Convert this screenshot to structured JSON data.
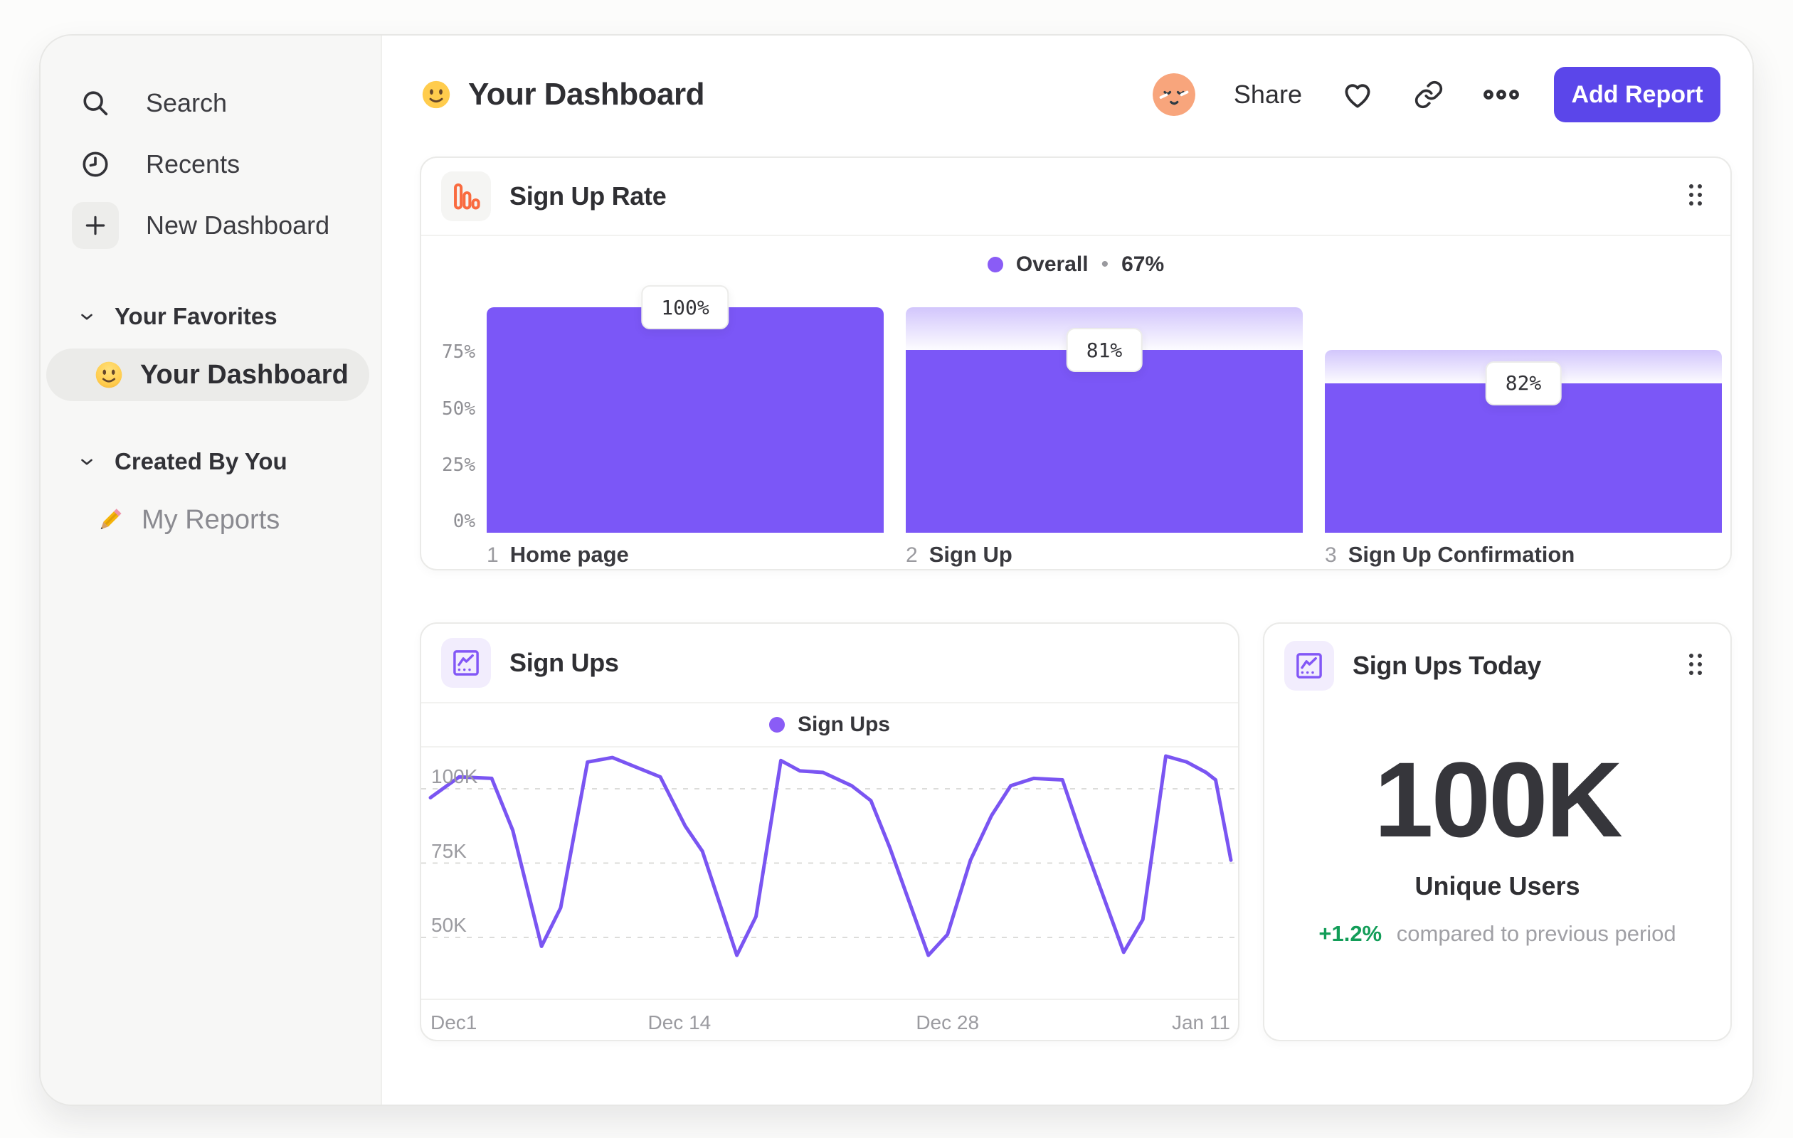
{
  "page": {
    "title": "Your Dashboard",
    "title_emoji": "slightly-smiling-face"
  },
  "sidebar": {
    "items": [
      {
        "label": "Search",
        "icon": "search-icon"
      },
      {
        "label": "Recents",
        "icon": "clock-icon"
      },
      {
        "label": "New Dashboard",
        "icon": "plus-icon"
      }
    ],
    "sections": [
      {
        "label": "Your Favorites",
        "items": [
          {
            "emoji": "🙂",
            "label": "Your Dashboard",
            "active": true
          }
        ]
      },
      {
        "label": "Created By You",
        "items": [
          {
            "emoji": "✏️",
            "label": "My Reports",
            "active": false
          }
        ]
      }
    ]
  },
  "header": {
    "share_label": "Share",
    "add_report_label": "Add Report"
  },
  "cards": {
    "funnel": {
      "title": "Sign Up Rate",
      "legend": {
        "name": "Overall",
        "sep": "•",
        "value": "67%"
      }
    },
    "line": {
      "title": "Sign Ups",
      "legend": {
        "name": "Sign Ups"
      }
    },
    "today": {
      "title": "Sign Ups Today",
      "value": "100K",
      "label": "Unique Users",
      "delta": "+1.2%",
      "delta_note": "compared to previous period"
    }
  },
  "colors": {
    "accent_purple": "#7b57f7",
    "button_purple": "#5b46ea",
    "icon_orange": "#f96b40",
    "delta_green": "#129d58",
    "legend_dot": "#8a5cf6"
  },
  "chart_data": [
    {
      "type": "bar",
      "subtype": "funnel",
      "title": "Sign Up Rate",
      "series": "Overall",
      "overall_conversion": "67%",
      "categories": [
        "Home page",
        "Sign Up",
        "Sign Up Confirmation"
      ],
      "step_numbers": [
        "1",
        "2",
        "3"
      ],
      "step_conversion_labels": [
        "100%",
        "81%",
        "82%"
      ],
      "cumulative_pct": [
        100,
        81,
        66.4
      ],
      "prev_cumulative_pct": [
        100,
        100,
        81
      ],
      "y_ticks": [
        {
          "v": 0,
          "label": "0%"
        },
        {
          "v": 25,
          "label": "25%"
        },
        {
          "v": 50,
          "label": "50%"
        },
        {
          "v": 75,
          "label": "75%"
        }
      ],
      "ylim": [
        0,
        100
      ],
      "grid": false,
      "legend_position": "top-center"
    },
    {
      "type": "line",
      "title": "Sign Ups",
      "series": "Sign Ups",
      "unit": "K",
      "x_ticks": [
        {
          "day": 0,
          "label": "Dec1"
        },
        {
          "day": 13,
          "label": "Dec 14"
        },
        {
          "day": 27,
          "label": "Dec 28"
        },
        {
          "day": 41,
          "label": "Jan 11"
        }
      ],
      "y_ticks": [
        {
          "v": 50,
          "label": "50K"
        },
        {
          "v": 75,
          "label": "75K"
        },
        {
          "v": 100,
          "label": "100K"
        }
      ],
      "xlim": [
        0,
        41.8
      ],
      "ylim": [
        35,
        117
      ],
      "grid": "dashed-horizontal",
      "legend_position": "top-center",
      "points": [
        [
          0,
          97
        ],
        [
          1.5,
          104
        ],
        [
          3.2,
          103.5
        ],
        [
          4.3,
          86
        ],
        [
          5.8,
          47
        ],
        [
          6.8,
          60
        ],
        [
          8.2,
          109
        ],
        [
          9.5,
          110.5
        ],
        [
          12,
          104
        ],
        [
          13.3,
          87.5
        ],
        [
          14.2,
          79
        ],
        [
          16,
          44
        ],
        [
          17,
          57
        ],
        [
          18.3,
          109.5
        ],
        [
          19.3,
          106
        ],
        [
          20.5,
          105.5
        ],
        [
          22,
          101
        ],
        [
          23,
          96
        ],
        [
          24,
          80
        ],
        [
          26,
          44
        ],
        [
          27,
          51
        ],
        [
          28.2,
          76
        ],
        [
          29.3,
          91
        ],
        [
          30.3,
          101
        ],
        [
          31.5,
          103.5
        ],
        [
          33,
          103
        ],
        [
          34,
          84
        ],
        [
          36.2,
          45
        ],
        [
          37.2,
          56
        ],
        [
          38.4,
          111
        ],
        [
          39.5,
          109
        ],
        [
          40.5,
          105.5
        ],
        [
          41,
          103
        ],
        [
          41.8,
          76
        ]
      ]
    }
  ]
}
